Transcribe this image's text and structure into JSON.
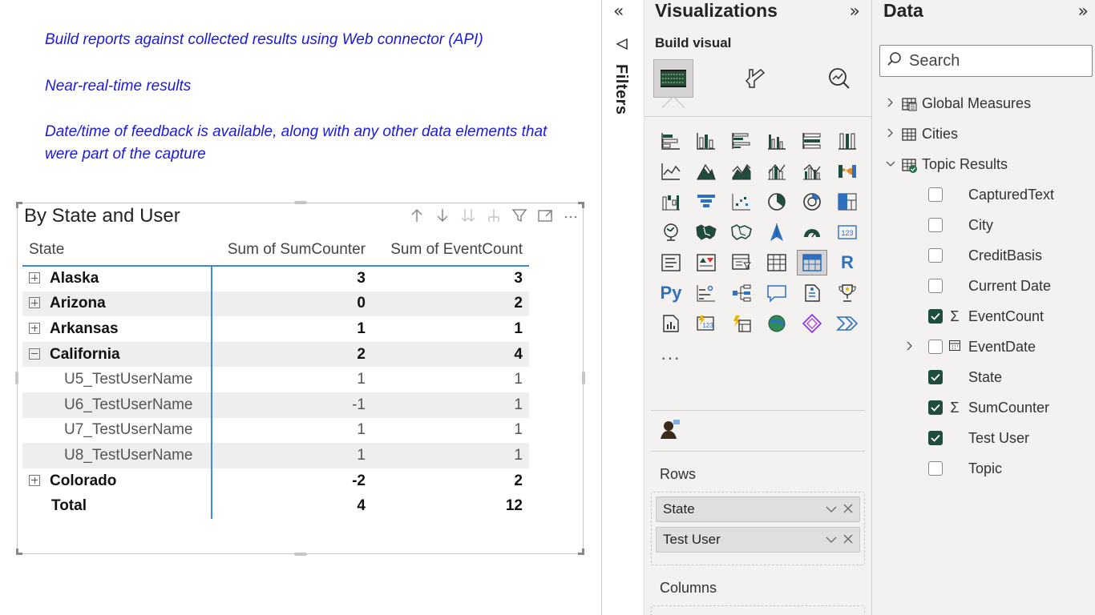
{
  "notes": {
    "line1": "Build reports against collected results using Web connector (API)",
    "line2": "Near-real-time results",
    "line3": "Date/time of feedback is available, along with any other data elements that were part of the capture"
  },
  "visual": {
    "title": "By State and User",
    "columns": [
      "State",
      "Sum of SumCounter",
      "Sum of EventCount"
    ],
    "rows": [
      {
        "state": "Alaska",
        "sum_counter": "3",
        "event_count": "3",
        "level": 0,
        "expander": "plus"
      },
      {
        "state": "Arizona",
        "sum_counter": "0",
        "event_count": "2",
        "level": 0,
        "expander": "plus"
      },
      {
        "state": "Arkansas",
        "sum_counter": "1",
        "event_count": "1",
        "level": 0,
        "expander": "plus"
      },
      {
        "state": "California",
        "sum_counter": "2",
        "event_count": "4",
        "level": 0,
        "expander": "minus"
      },
      {
        "state": "U5_TestUserName",
        "sum_counter": "1",
        "event_count": "1",
        "level": 1
      },
      {
        "state": "U6_TestUserName",
        "sum_counter": "-1",
        "event_count": "1",
        "level": 1
      },
      {
        "state": "U7_TestUserName",
        "sum_counter": "1",
        "event_count": "1",
        "level": 1
      },
      {
        "state": "U8_TestUserName",
        "sum_counter": "1",
        "event_count": "1",
        "level": 1
      },
      {
        "state": "Colorado",
        "sum_counter": "-2",
        "event_count": "2",
        "level": 0,
        "expander": "plus"
      }
    ],
    "total": {
      "label": "Total",
      "sum_counter": "4",
      "event_count": "12"
    },
    "header_icons": [
      "arrow-up-icon",
      "arrow-down-icon",
      "double-arrow-down-icon",
      "expand-hierarchy-icon",
      "filter-icon",
      "focus-mode-icon",
      "more-options-icon"
    ]
  },
  "filters": {
    "label": "Filters"
  },
  "visualizations": {
    "title": "Visualizations",
    "build_visual_label": "Build visual",
    "rows_label": "Rows",
    "rows_fields": [
      "State",
      "Test User"
    ],
    "columns_label": "Columns",
    "r_label": "R",
    "py_label": "Py",
    "more_label": "..."
  },
  "data": {
    "title": "Data",
    "search_placeholder": "Search",
    "tables": [
      {
        "name": "Global Measures",
        "expanded": false
      },
      {
        "name": "Cities",
        "expanded": false
      },
      {
        "name": "Topic Results",
        "expanded": true
      }
    ],
    "fields": [
      {
        "name": "CapturedText",
        "checked": false,
        "type": ""
      },
      {
        "name": "City",
        "checked": false,
        "type": ""
      },
      {
        "name": "CreditBasis",
        "checked": false,
        "type": ""
      },
      {
        "name": "Current Date",
        "checked": false,
        "type": ""
      },
      {
        "name": "EventCount",
        "checked": true,
        "type": "sigma"
      },
      {
        "name": "EventDate",
        "checked": false,
        "type": "date"
      },
      {
        "name": "State",
        "checked": true,
        "type": ""
      },
      {
        "name": "SumCounter",
        "checked": true,
        "type": "sigma"
      },
      {
        "name": "Test User",
        "checked": true,
        "type": ""
      },
      {
        "name": "Topic",
        "checked": false,
        "type": ""
      }
    ]
  },
  "colors": {
    "note_text": "#1a1adf",
    "accent_blue": "#3c8ae6",
    "checkbox_checked": "#1f4d3d",
    "pane_bg": "#f3f2f1"
  }
}
